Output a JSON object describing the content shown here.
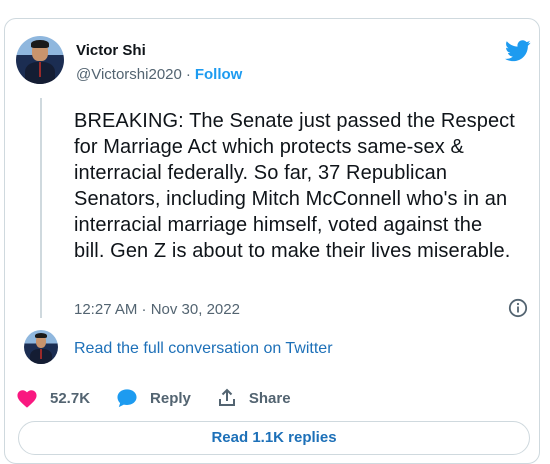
{
  "author": {
    "name": "Victor Shi",
    "handle": "@Victorshi2020",
    "separator": "·",
    "follow_label": "Follow"
  },
  "tweet": {
    "text": "BREAKING: The Senate just passed the Respect for Marriage Act which protects same-sex & interracial federally. So far, 37 Republican Senators, including Mitch McConnell who's in an interracial marriage himself, voted against the bill. Gen Z is about to make their lives miserable.",
    "timestamp": "12:27 AM · Nov 30, 2022"
  },
  "conversation_link": "Read the full conversation on Twitter",
  "actions": {
    "likes": "52.7K",
    "reply_label": "Reply",
    "share_label": "Share"
  },
  "read_replies_label": "Read 1.1K replies",
  "colors": {
    "accent": "#1d9bf0",
    "link": "#1d70b8",
    "like": "#f91880",
    "muted": "#536471",
    "border": "#cfd9de"
  },
  "icons": [
    "twitter-bird-icon",
    "info-icon",
    "heart-icon",
    "reply-bubble-icon",
    "share-icon"
  ]
}
